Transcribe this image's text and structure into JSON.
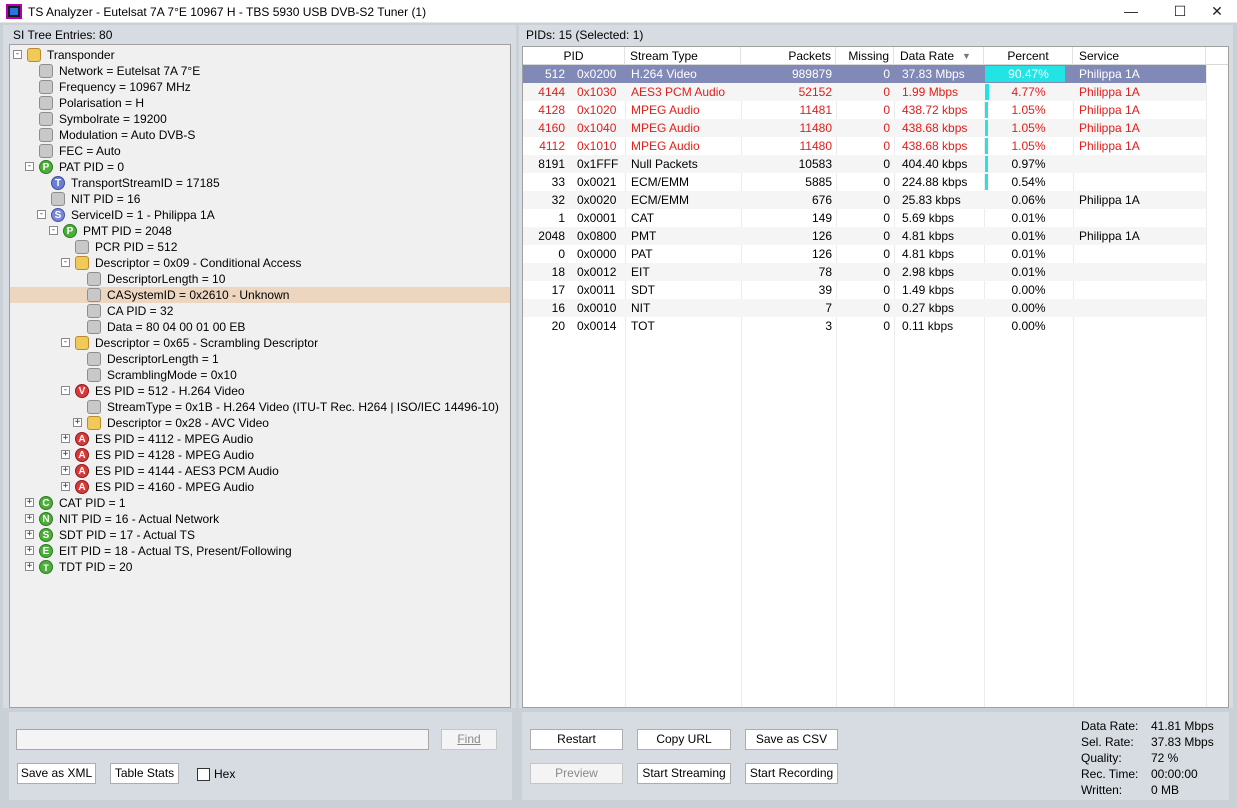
{
  "window": {
    "title": "TS Analyzer - Eutelsat 7A 7°E 10967 H - TBS 5930 USB DVB-S2 Tuner (1)",
    "minimize_glyph": "—",
    "maximize_glyph": "☐",
    "close_glyph": "✕"
  },
  "left": {
    "header": "SI Tree Entries: 80",
    "tree": [
      {
        "text": "Transponder",
        "icon": "folder",
        "badge": "",
        "level": 0,
        "expander": "-"
      },
      {
        "text": "Network = Eutelsat 7A 7°E",
        "icon": "leaf",
        "badge": "",
        "level": 1,
        "expander": ""
      },
      {
        "text": "Frequency = 10967 MHz",
        "icon": "leaf",
        "badge": "",
        "level": 1,
        "expander": ""
      },
      {
        "text": "Polarisation = H",
        "icon": "leaf",
        "badge": "",
        "level": 1,
        "expander": ""
      },
      {
        "text": "Symbolrate = 19200",
        "icon": "leaf",
        "badge": "",
        "level": 1,
        "expander": ""
      },
      {
        "text": "Modulation = Auto DVB-S",
        "icon": "leaf",
        "badge": "",
        "level": 1,
        "expander": ""
      },
      {
        "text": "FEC = Auto",
        "icon": "leaf",
        "badge": "",
        "level": 1,
        "expander": ""
      },
      {
        "text": "PAT PID = 0",
        "icon": "P",
        "badge": "P",
        "level": 1,
        "expander": "-"
      },
      {
        "text": "TransportStreamID = 17185",
        "icon": "T",
        "badge": "T",
        "level": 2,
        "expander": ""
      },
      {
        "text": "NIT PID = 16",
        "icon": "leaf",
        "badge": "",
        "level": 2,
        "expander": ""
      },
      {
        "text": "ServiceID = 1 - Philippa 1A",
        "icon": "S",
        "badge": "S",
        "level": 2,
        "expander": "-"
      },
      {
        "text": "PMT PID = 2048",
        "icon": "P",
        "badge": "P",
        "level": 3,
        "expander": "-"
      },
      {
        "text": "PCR PID = 512",
        "icon": "leaf",
        "badge": "",
        "level": 4,
        "expander": ""
      },
      {
        "text": "Descriptor = 0x09 - Conditional Access",
        "icon": "folder",
        "badge": "",
        "level": 4,
        "expander": "-"
      },
      {
        "text": "DescriptorLength = 10",
        "icon": "leaf",
        "badge": "",
        "level": 5,
        "expander": ""
      },
      {
        "text": "CASystemID = 0x2610 - Unknown",
        "icon": "leaf",
        "badge": "",
        "level": 5,
        "expander": "",
        "selected": true
      },
      {
        "text": "CA PID = 32",
        "icon": "leaf",
        "badge": "",
        "level": 5,
        "expander": ""
      },
      {
        "text": "Data = 80 04 00 01 00 EB",
        "icon": "leaf",
        "badge": "",
        "level": 5,
        "expander": ""
      },
      {
        "text": "Descriptor = 0x65 - Scrambling Descriptor",
        "icon": "folder",
        "badge": "",
        "level": 4,
        "expander": "-"
      },
      {
        "text": "DescriptorLength = 1",
        "icon": "leaf",
        "badge": "",
        "level": 5,
        "expander": ""
      },
      {
        "text": "ScramblingMode = 0x10",
        "icon": "leaf",
        "badge": "",
        "level": 5,
        "expander": ""
      },
      {
        "text": "ES PID = 512 - H.264 Video",
        "icon": "V",
        "badge": "V",
        "level": 4,
        "expander": "-"
      },
      {
        "text": "StreamType = 0x1B - H.264 Video (ITU-T Rec. H264 | ISO/IEC 14496-10)",
        "icon": "leaf",
        "badge": "",
        "level": 5,
        "expander": ""
      },
      {
        "text": "Descriptor = 0x28 - AVC Video",
        "icon": "folder",
        "badge": "",
        "level": 5,
        "expander": "+"
      },
      {
        "text": "ES PID = 4112 - MPEG Audio",
        "icon": "A",
        "badge": "A",
        "level": 4,
        "expander": "+"
      },
      {
        "text": "ES PID = 4128 - MPEG Audio",
        "icon": "A",
        "badge": "A",
        "level": 4,
        "expander": "+"
      },
      {
        "text": "ES PID = 4144 - AES3 PCM Audio",
        "icon": "A",
        "badge": "A",
        "level": 4,
        "expander": "+"
      },
      {
        "text": "ES PID = 4160 - MPEG Audio",
        "icon": "A",
        "badge": "A",
        "level": 4,
        "expander": "+"
      },
      {
        "text": "CAT PID = 1",
        "icon": "C",
        "badge": "C",
        "level": 1,
        "expander": "+"
      },
      {
        "text": "NIT PID = 16 - Actual Network",
        "icon": "N",
        "badge": "N",
        "level": 1,
        "expander": "+"
      },
      {
        "text": "SDT PID = 17 - Actual TS",
        "icon": "S2",
        "badge": "S",
        "level": 1,
        "expander": "+"
      },
      {
        "text": "EIT PID = 18 - Actual TS, Present/Following",
        "icon": "E",
        "badge": "E",
        "level": 1,
        "expander": "+"
      },
      {
        "text": "TDT PID = 20",
        "icon": "TDT",
        "badge": "T",
        "level": 1,
        "expander": "+"
      }
    ],
    "search_value": "",
    "find_label": "Find",
    "save_xml_label": "Save as XML",
    "table_stats_label": "Table Stats",
    "hex_label": "Hex"
  },
  "right": {
    "header": "PIDs: 15   (Selected: 1)",
    "columns": [
      "PID",
      "Stream Type",
      "Packets",
      "Missing",
      "Data Rate",
      "Percent",
      "Service"
    ],
    "sort_glyph": "▼",
    "rows": [
      {
        "pid": "512",
        "hex": "0x0200",
        "type": "H.264 Video",
        "packets": "989879",
        "missing": "0",
        "rate": "37.83 Mbps",
        "pct": "90.47%",
        "pct_value": 90.47,
        "service": "Philippa 1A",
        "style": "sel"
      },
      {
        "pid": "4144",
        "hex": "0x1030",
        "type": "AES3 PCM Audio",
        "packets": "52152",
        "missing": "0",
        "rate": "1.99 Mbps",
        "pct": "4.77%",
        "pct_value": 4.77,
        "service": "Philippa 1A",
        "style": "red"
      },
      {
        "pid": "4128",
        "hex": "0x1020",
        "type": "MPEG Audio",
        "packets": "11481",
        "missing": "0",
        "rate": "438.72 kbps",
        "pct": "1.05%",
        "pct_value": 1.05,
        "service": "Philippa 1A",
        "style": "red"
      },
      {
        "pid": "4160",
        "hex": "0x1040",
        "type": "MPEG Audio",
        "packets": "11480",
        "missing": "0",
        "rate": "438.68 kbps",
        "pct": "1.05%",
        "pct_value": 1.05,
        "service": "Philippa 1A",
        "style": "red"
      },
      {
        "pid": "4112",
        "hex": "0x1010",
        "type": "MPEG Audio",
        "packets": "11480",
        "missing": "0",
        "rate": "438.68 kbps",
        "pct": "1.05%",
        "pct_value": 1.05,
        "service": "Philippa 1A",
        "style": "red"
      },
      {
        "pid": "8191",
        "hex": "0x1FFF",
        "type": "Null Packets",
        "packets": "10583",
        "missing": "0",
        "rate": "404.40 kbps",
        "pct": "0.97%",
        "pct_value": 0.97,
        "service": "",
        "style": ""
      },
      {
        "pid": "33",
        "hex": "0x0021",
        "type": "ECM/EMM",
        "packets": "5885",
        "missing": "0",
        "rate": "224.88 kbps",
        "pct": "0.54%",
        "pct_value": 0.54,
        "service": "",
        "style": ""
      },
      {
        "pid": "32",
        "hex": "0x0020",
        "type": "ECM/EMM",
        "packets": "676",
        "missing": "0",
        "rate": "25.83 kbps",
        "pct": "0.06%",
        "pct_value": 0.06,
        "service": "Philippa 1A",
        "style": ""
      },
      {
        "pid": "1",
        "hex": "0x0001",
        "type": "CAT",
        "packets": "149",
        "missing": "0",
        "rate": "5.69 kbps",
        "pct": "0.01%",
        "pct_value": 0.01,
        "service": "",
        "style": ""
      },
      {
        "pid": "2048",
        "hex": "0x0800",
        "type": "PMT",
        "packets": "126",
        "missing": "0",
        "rate": "4.81 kbps",
        "pct": "0.01%",
        "pct_value": 0.01,
        "service": "Philippa 1A",
        "style": ""
      },
      {
        "pid": "0",
        "hex": "0x0000",
        "type": "PAT",
        "packets": "126",
        "missing": "0",
        "rate": "4.81 kbps",
        "pct": "0.01%",
        "pct_value": 0.01,
        "service": "",
        "style": ""
      },
      {
        "pid": "18",
        "hex": "0x0012",
        "type": "EIT",
        "packets": "78",
        "missing": "0",
        "rate": "2.98 kbps",
        "pct": "0.01%",
        "pct_value": 0.01,
        "service": "",
        "style": ""
      },
      {
        "pid": "17",
        "hex": "0x0011",
        "type": "SDT",
        "packets": "39",
        "missing": "0",
        "rate": "1.49 kbps",
        "pct": "0.00%",
        "pct_value": 0.0,
        "service": "",
        "style": ""
      },
      {
        "pid": "16",
        "hex": "0x0010",
        "type": "NIT",
        "packets": "7",
        "missing": "0",
        "rate": "0.27 kbps",
        "pct": "0.00%",
        "pct_value": 0.0,
        "service": "",
        "style": ""
      },
      {
        "pid": "20",
        "hex": "0x0014",
        "type": "TOT",
        "packets": "3",
        "missing": "0",
        "rate": "0.11 kbps",
        "pct": "0.00%",
        "pct_value": 0.0,
        "service": "",
        "style": ""
      }
    ],
    "buttons": {
      "restart": "Restart",
      "copy_url": "Copy URL",
      "save_csv": "Save as CSV",
      "preview": "Preview",
      "start_streaming": "Start Streaming",
      "start_recording": "Start Recording"
    },
    "stats": [
      {
        "label": "Data Rate:",
        "value": "41.81 Mbps"
      },
      {
        "label": "Sel. Rate:",
        "value": "37.83 Mbps"
      },
      {
        "label": "Quality:",
        "value": "72 %"
      },
      {
        "label": "Rec. Time:",
        "value": "00:00:00"
      },
      {
        "label": "Written:",
        "value": "0 MB"
      }
    ]
  },
  "colors": {
    "selected_row": "#8189b6",
    "red_text": "#e0201c",
    "percent_bar": "#22e4e4",
    "tree_selection": "#ecd6c0"
  }
}
